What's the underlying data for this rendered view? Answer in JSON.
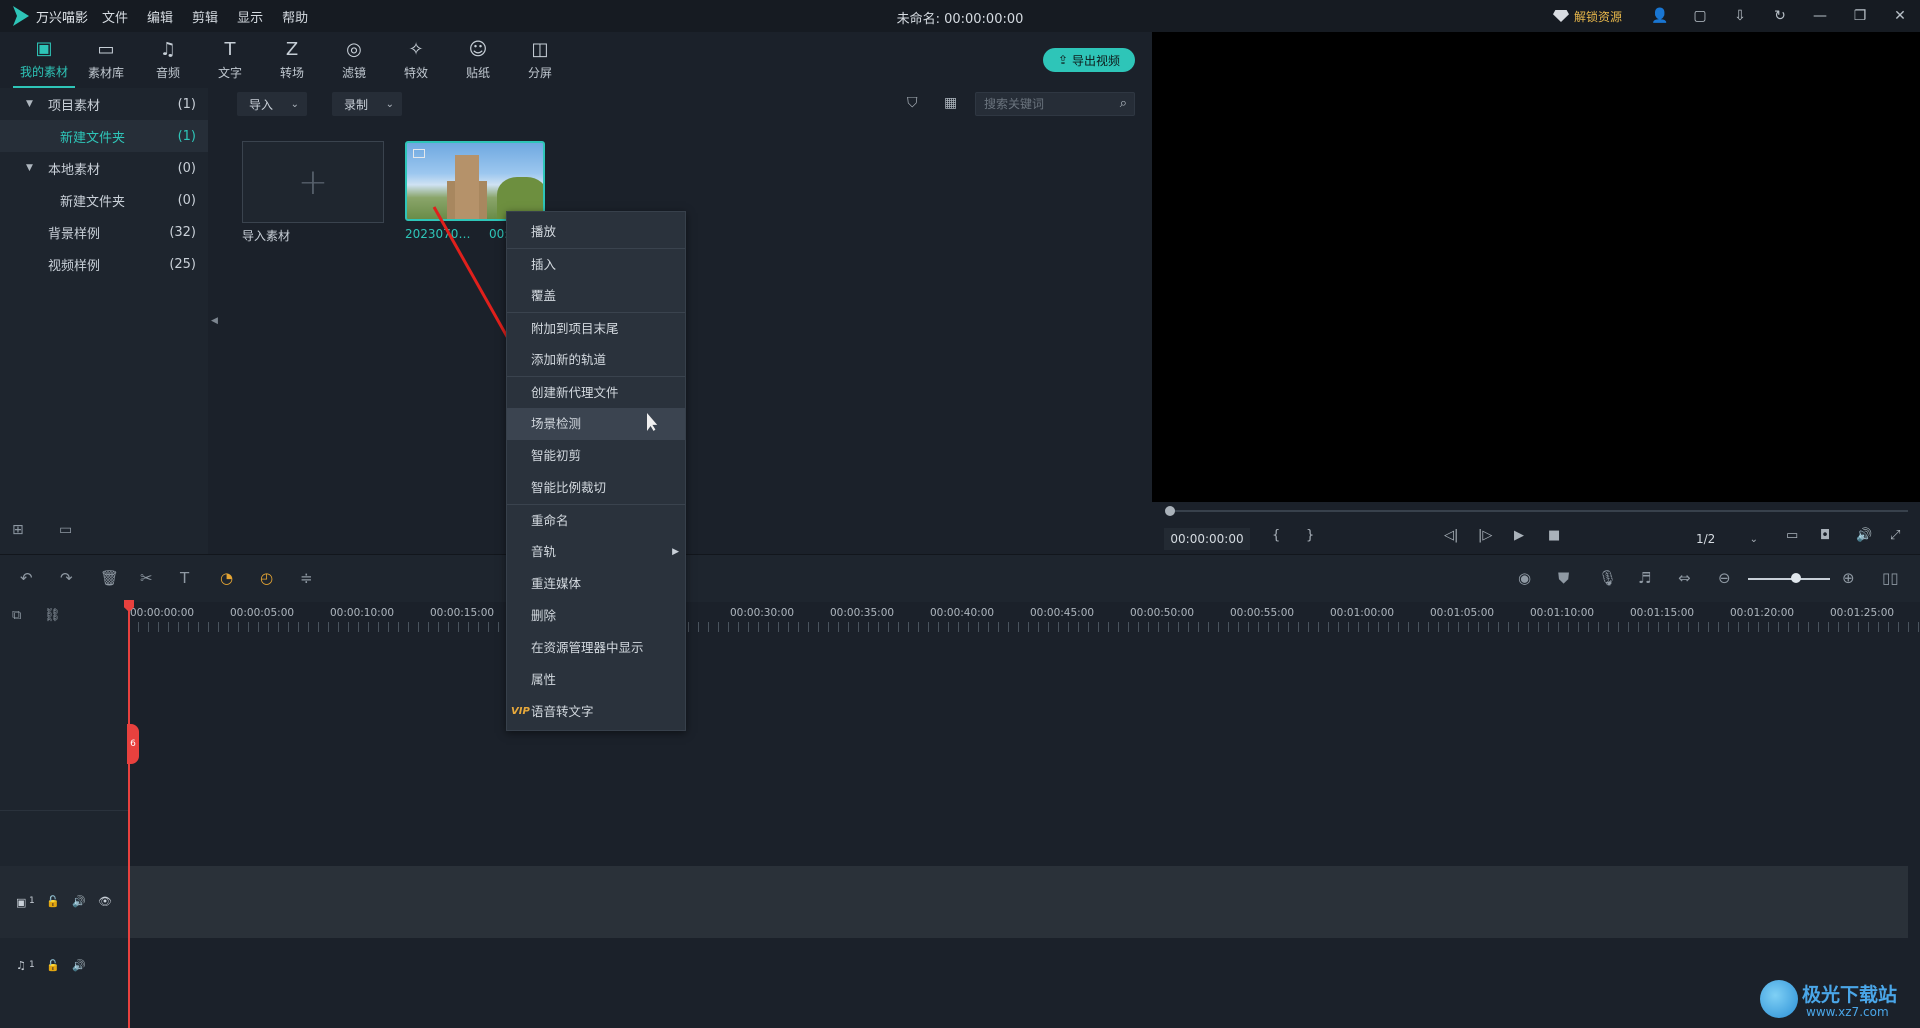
{
  "app": {
    "name": "万兴喵影",
    "menu": [
      "文件",
      "编辑",
      "剪辑",
      "显示",
      "帮助"
    ],
    "window_title": "未命名: 00:00:00:00",
    "unlock_label": "解锁资源"
  },
  "tabs": [
    {
      "label": "我的素材",
      "icon": "folder-media-icon",
      "glyph": "▣",
      "active": true
    },
    {
      "label": "素材库",
      "icon": "folder-icon",
      "glyph": "▭",
      "active": false
    },
    {
      "label": "音频",
      "icon": "music-note-icon",
      "glyph": "♫",
      "active": false
    },
    {
      "label": "文字",
      "icon": "text-icon",
      "glyph": "T",
      "active": false
    },
    {
      "label": "转场",
      "icon": "transition-icon",
      "glyph": "Z",
      "active": false
    },
    {
      "label": "滤镜",
      "icon": "filter-icon",
      "glyph": "◎",
      "active": false
    },
    {
      "label": "特效",
      "icon": "effects-icon",
      "glyph": "✧",
      "active": false
    },
    {
      "label": "贴纸",
      "icon": "sticker-icon",
      "glyph": "☺",
      "active": false
    },
    {
      "label": "分屏",
      "icon": "split-screen-icon",
      "glyph": "◫",
      "active": false
    }
  ],
  "export_label": "导出视频",
  "tree": [
    {
      "label": "项目素材",
      "count": "(1)",
      "expanded": true,
      "indent": 1
    },
    {
      "label": "新建文件夹",
      "count": "(1)",
      "selected": true,
      "indent": 2
    },
    {
      "label": "本地素材",
      "count": "(0)",
      "expanded": true,
      "indent": 1
    },
    {
      "label": "新建文件夹",
      "count": "(0)",
      "indent": 2
    },
    {
      "label": "背景样例",
      "count": "(32)",
      "indent": 1
    },
    {
      "label": "视频样例",
      "count": "(25)",
      "indent": 1
    }
  ],
  "media_toolbar": {
    "import_label": "导入",
    "record_label": "录制",
    "search_placeholder": "搜索关键词"
  },
  "media": {
    "import_tile_label": "导入素材",
    "clip_name": "2023070…",
    "clip_duration": "00:"
  },
  "context_menu": [
    {
      "label": "播放",
      "sep": false
    },
    {
      "label": "插入",
      "sep": true
    },
    {
      "label": "覆盖",
      "sep": false
    },
    {
      "label": "附加到项目末尾",
      "sep": true
    },
    {
      "label": "添加新的轨道",
      "sep": false
    },
    {
      "label": "创建新代理文件",
      "sep": true
    },
    {
      "label": "场景检测",
      "sep": false,
      "hover": true
    },
    {
      "label": "智能初剪",
      "sep": false
    },
    {
      "label": "智能比例裁切",
      "sep": false
    },
    {
      "label": "重命名",
      "sep": true
    },
    {
      "label": "音轨",
      "sep": false,
      "submenu": true
    },
    {
      "label": "重连媒体",
      "sep": false
    },
    {
      "label": "删除",
      "sep": false
    },
    {
      "label": "在资源管理器中显示",
      "sep": false
    },
    {
      "label": "属性",
      "sep": false
    },
    {
      "label": "语音转文字",
      "sep": false,
      "vip": true
    }
  ],
  "vip_badge": "VIP",
  "preview": {
    "time": "00:00:00:00",
    "mark_in": "{",
    "mark_out": "}",
    "ratio": "1/2"
  },
  "ruler_ticks": [
    "00:00:00:00",
    "00:00:05:00",
    "00:00:10:00",
    "00:00:15:00",
    "00:00:30:00",
    "00:00:35:00",
    "00:00:40:00",
    "00:00:45:00",
    "00:00:50:00",
    "00:00:55:00",
    "00:01:00:00",
    "00:01:05:00",
    "00:01:10:00",
    "00:01:15:00",
    "00:01:20:00",
    "00:01:25:00"
  ],
  "tracks": {
    "video_label": "1",
    "audio_label": "1"
  },
  "playhead_tag": "6",
  "watermark": {
    "name": "极光下载站",
    "url": "www.xz7.com"
  }
}
